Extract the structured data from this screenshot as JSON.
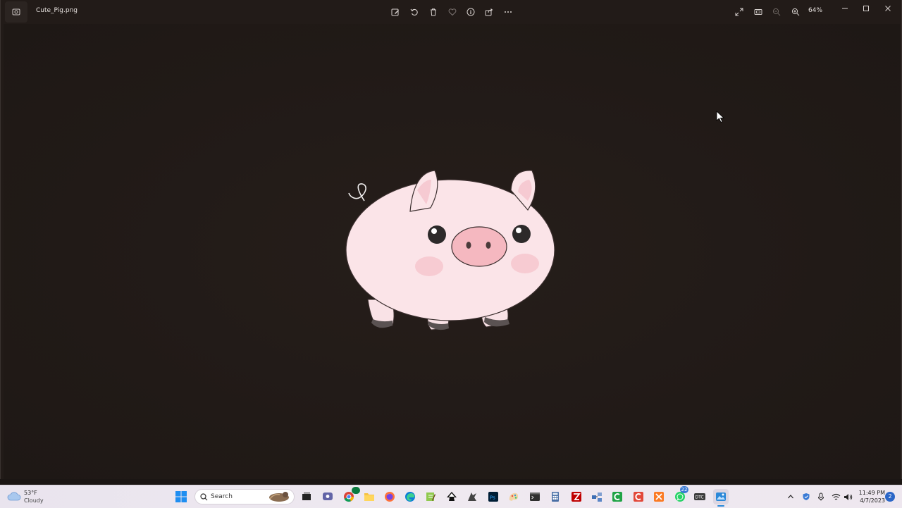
{
  "titlebar": {
    "file_name": "Cute_Pig.png",
    "zoom": "64%"
  },
  "toolbar_icons": [
    "edit-icon",
    "rotate-icon",
    "delete-icon",
    "favorite-icon",
    "info-icon",
    "share-icon",
    "more-icon"
  ],
  "view_icons": [
    "fullscreen-icon",
    "fit-icon",
    "zoom-out-icon",
    "zoom-in-icon"
  ],
  "taskbar": {
    "weather": {
      "temp": "53°F",
      "condition": "Cloudy"
    },
    "search_label": "Search",
    "chat_badge": "22",
    "clock": {
      "time": "11:49 PM",
      "date": "4/7/2023"
    },
    "notifications": "2"
  },
  "colors": {
    "background": "#221b18",
    "pig_body": "#fbe4e8",
    "pig_snout": "#f5b8c0",
    "accent": "#3a7bd5"
  }
}
